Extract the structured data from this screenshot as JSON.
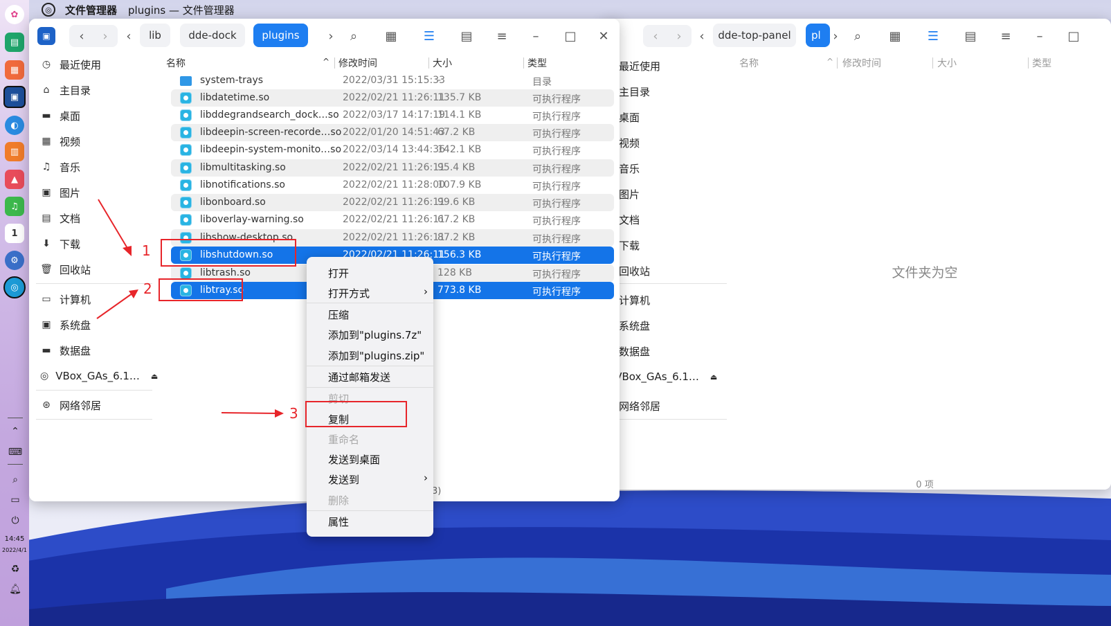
{
  "titlebar": {
    "app_name": "文件管理器",
    "window_path": "plugins — 文件管理器"
  },
  "dock": {
    "time": "14:45",
    "date": "2022/4/1"
  },
  "left_window": {
    "breadcrumbs": [
      "lib",
      "dde-dock",
      "plugins"
    ],
    "active_crumb": "plugins",
    "sidebar": {
      "items": [
        "最近使用",
        "主目录",
        "桌面",
        "视频",
        "音乐",
        "图片",
        "文档",
        "下载",
        "回收站"
      ],
      "devices": [
        "计算机",
        "系统盘",
        "数据盘",
        "VBox_GAs_6.1…"
      ],
      "network": [
        "网络邻居"
      ]
    },
    "columns": {
      "name": "名称",
      "modified": "修改时间",
      "size": "大小",
      "type": "类型"
    },
    "files": [
      {
        "name": "system-trays",
        "modified": "2022/03/31 15:15:33",
        "size": "-",
        "type": "目录",
        "kind": "folder"
      },
      {
        "name": "libdatetime.so",
        "modified": "2022/02/21 11:26:11",
        "size": "135.7 KB",
        "type": "可执行程序"
      },
      {
        "name": "libddegrandsearch_dock…so",
        "modified": "2022/03/17 14:17:19",
        "size": "114.1 KB",
        "type": "可执行程序"
      },
      {
        "name": "libdeepin-screen-recorde…so",
        "modified": "2022/01/20 14:51:43",
        "size": "67.2 KB",
        "type": "可执行程序"
      },
      {
        "name": "libdeepin-system-monito…so",
        "modified": "2022/03/14 13:44:36",
        "size": "142.1 KB",
        "type": "可执行程序"
      },
      {
        "name": "libmultitasking.so",
        "modified": "2022/02/21 11:26:11",
        "size": "95.4 KB",
        "type": "可执行程序"
      },
      {
        "name": "libnotifications.so",
        "modified": "2022/02/21 11:28:00",
        "size": "107.9 KB",
        "type": "可执行程序"
      },
      {
        "name": "libonboard.so",
        "modified": "2022/02/21 11:26:11",
        "size": "99.6 KB",
        "type": "可执行程序"
      },
      {
        "name": "liboverlay-warning.so",
        "modified": "2022/02/21 11:26:11",
        "size": "67.2 KB",
        "type": "可执行程序"
      },
      {
        "name": "libshow-desktop.so",
        "modified": "2022/02/21 11:26:11",
        "size": "87.2 KB",
        "type": "可执行程序"
      },
      {
        "name": "libshutdown.so",
        "modified": "2022/02/21 11:26:11",
        "size": "156.3 KB",
        "type": "可执行程序",
        "selected": true
      },
      {
        "name": "libtrash.so",
        "modified": "",
        "size": "128 KB",
        "type": "可执行程序"
      },
      {
        "name": "libtray.so",
        "modified": "",
        "size": "773.8 KB",
        "type": "可执行程序",
        "selected": true
      }
    ],
    "status_fragment": "3)"
  },
  "context_menu": {
    "items": [
      "打开",
      "打开方式",
      "压缩",
      "添加到\"plugins.7z\"",
      "添加到\"plugins.zip\"",
      "通过邮箱发送",
      "剪切",
      "复制",
      "重命名",
      "发送到桌面",
      "发送到",
      "删除",
      "属性"
    ]
  },
  "annotations": {
    "step1": "1",
    "step2": "2",
    "step3": "3"
  },
  "right_window": {
    "breadcrumbs": [
      "dde-top-panel",
      "pl"
    ],
    "sidebar": {
      "items": [
        "最近使用",
        "主目录",
        "桌面",
        "视频",
        "音乐",
        "图片",
        "文档",
        "下载",
        "回收站"
      ],
      "devices": [
        "计算机",
        "系统盘",
        "数据盘",
        "VBox_GAs_6.1…"
      ],
      "network": [
        "网络邻居"
      ]
    },
    "columns": {
      "name": "名称",
      "modified": "修改时间",
      "size": "大小",
      "type": "类型"
    },
    "empty_text": "文件夹为空",
    "count_text": "0 项"
  },
  "icons": {
    "eject": "⏏",
    "sort_up": "^"
  },
  "colors": {
    "accent": "#1474e8",
    "annotation": "#e7252a"
  }
}
